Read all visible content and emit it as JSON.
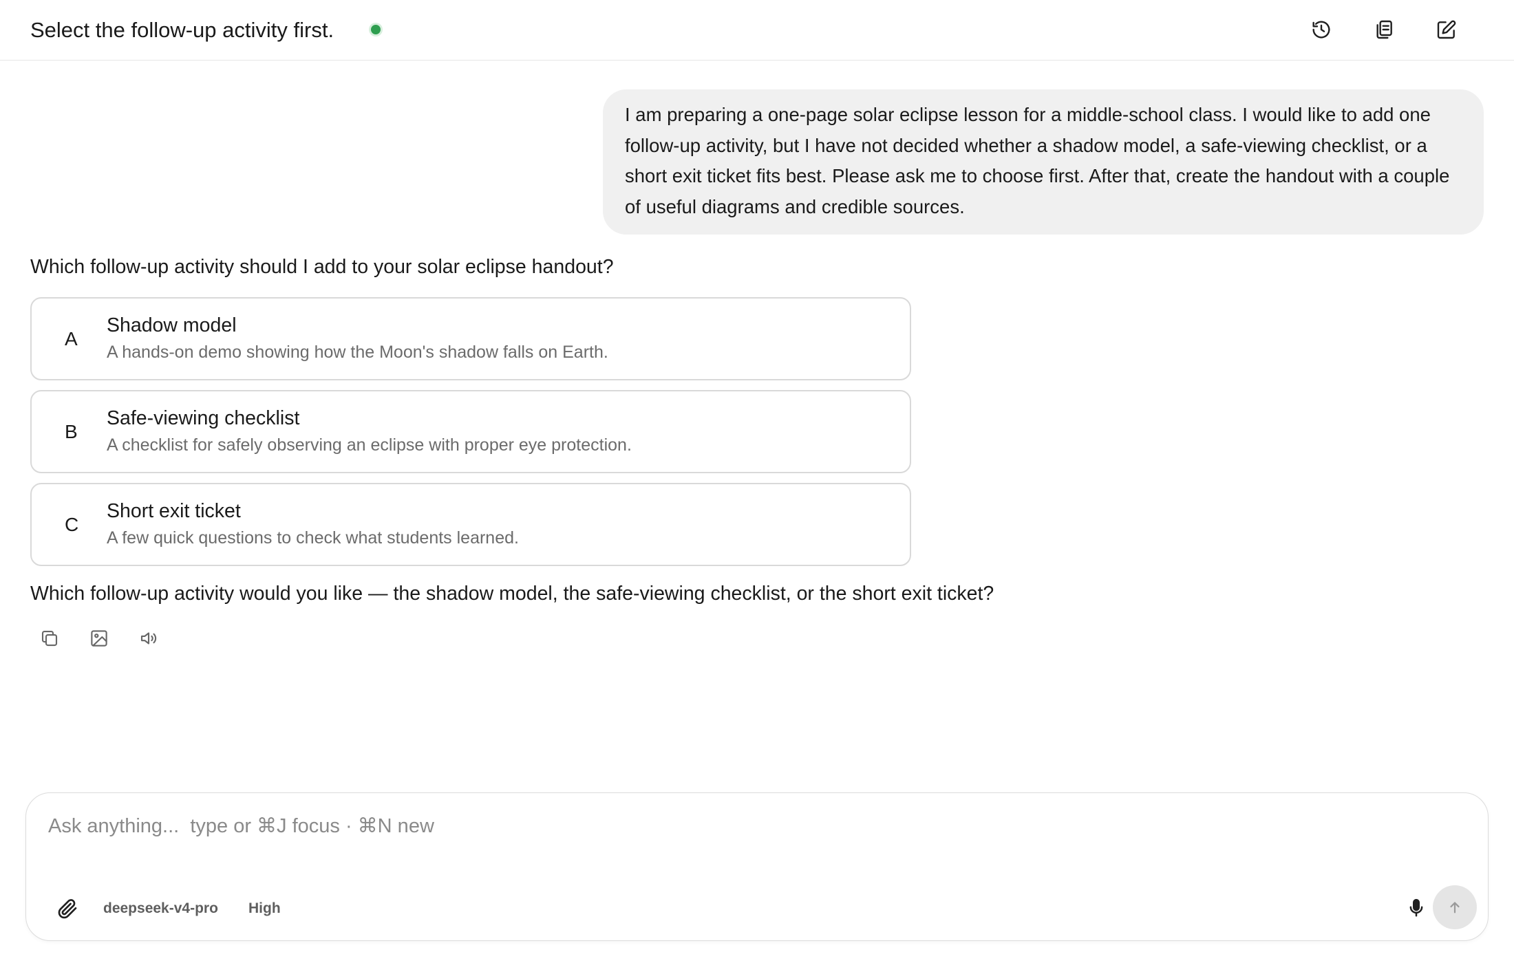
{
  "header": {
    "title": "Select the follow-up activity first.",
    "status_color": "#2e9e4f",
    "actions": [
      {
        "icon": "history-icon"
      },
      {
        "icon": "copy-icon"
      },
      {
        "icon": "edit-icon"
      }
    ]
  },
  "conversation": {
    "user_message": "I am preparing a one-page solar eclipse lesson for a middle-school class. I would like to add one follow-up activity, but I have not decided whether a shadow model, a safe-viewing checklist, or a short exit ticket fits best. Please ask me to choose first. After that, create the handout with a couple of useful diagrams and credible sources.",
    "question": "Which follow-up activity should I add to your solar eclipse handout?",
    "options": [
      {
        "letter": "A",
        "title": "Shadow model",
        "description": "A hands-on demo showing how the Moon's shadow falls on Earth."
      },
      {
        "letter": "B",
        "title": "Safe-viewing checklist",
        "description": "A checklist for safely observing an eclipse with proper eye protection."
      },
      {
        "letter": "C",
        "title": "Short exit ticket",
        "description": "A few quick questions to check what students learned."
      }
    ],
    "answer": "Which follow-up activity would you like — the shadow model, the safe-viewing checklist, or the short exit ticket?",
    "message_actions": [
      {
        "icon": "copy-icon"
      },
      {
        "icon": "image-icon"
      },
      {
        "icon": "speaker-icon"
      }
    ]
  },
  "composer": {
    "placeholder": "Ask anything...  type or ⌘J focus · ⌘N new",
    "model": "deepseek-v4-pro",
    "effort": "High"
  }
}
